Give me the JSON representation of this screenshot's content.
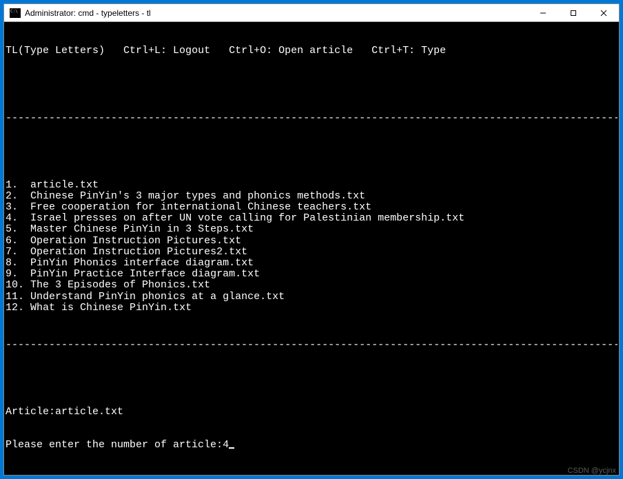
{
  "window": {
    "title": "Administrator: cmd - typeletters - tl"
  },
  "header": {
    "app_name": "TL(Type Letters)",
    "shortcuts": {
      "logout": "Ctrl+L: Logout",
      "open": "Ctrl+O: Open article",
      "type": "Ctrl+T: Type"
    }
  },
  "divider": "------------------------------------------------------------------------------------------------------------------",
  "files": [
    {
      "num": "1.",
      "name": "article.txt"
    },
    {
      "num": "2.",
      "name": "Chinese PinYin's 3 major types and phonics methods.txt"
    },
    {
      "num": "3.",
      "name": "Free cooperation for international Chinese teachers.txt"
    },
    {
      "num": "4.",
      "name": "Israel presses on after UN vote calling for Palestinian membership.txt"
    },
    {
      "num": "5.",
      "name": "Master Chinese PinYin in 3 Steps.txt"
    },
    {
      "num": "6.",
      "name": "Operation Instruction Pictures.txt"
    },
    {
      "num": "7.",
      "name": "Operation Instruction Pictures2.txt"
    },
    {
      "num": "8.",
      "name": "PinYin Phonics interface diagram.txt"
    },
    {
      "num": "9.",
      "name": "PinYin Practice Interface diagram.txt"
    },
    {
      "num": "10.",
      "name": "The 3 Episodes of Phonics.txt"
    },
    {
      "num": "11.",
      "name": "Understand PinYin phonics at a glance.txt"
    },
    {
      "num": "12.",
      "name": "What is Chinese PinYin.txt"
    }
  ],
  "footer": {
    "article_label": "Article:",
    "article_value": "article.txt",
    "prompt_label": "Please enter the number of article:",
    "prompt_value": "4"
  },
  "watermark": "CSDN @ycjnx"
}
